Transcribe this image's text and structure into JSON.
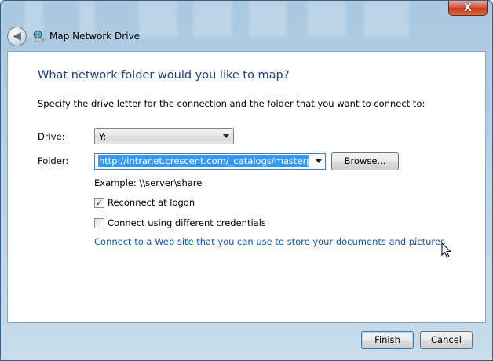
{
  "window": {
    "title": "Map Network Drive",
    "close_glyph": "X"
  },
  "header": {
    "back_glyph": "◀",
    "back_icon": "back-arrow-icon",
    "app_icon": "network-drive-icon"
  },
  "main": {
    "heading": "What network folder would you like to map?",
    "instructions": "Specify the drive letter for the connection and the folder that you want to connect to:",
    "drive_label": "Drive:",
    "drive_value": "Y:",
    "folder_label": "Folder:",
    "folder_value": "http://intranet.crescent.com/_catalogs/masterpage",
    "browse_label": "Browse...",
    "example_text": "Example: \\\\server\\share",
    "reconnect_label": "Reconnect at logon",
    "reconnect_checked": true,
    "different_credentials_label": "Connect using different credentials",
    "different_credentials_checked": false,
    "web_link_text": "Connect to a Web site that you can use to store your documents and pictures",
    "web_link_suffix": "."
  },
  "footer": {
    "finish_label": "Finish",
    "cancel_label": "Cancel"
  },
  "colors": {
    "heading": "#1e3f8a",
    "link": "#0b57b5",
    "selection": "#3399ff",
    "close_button": "#c33b1d"
  }
}
